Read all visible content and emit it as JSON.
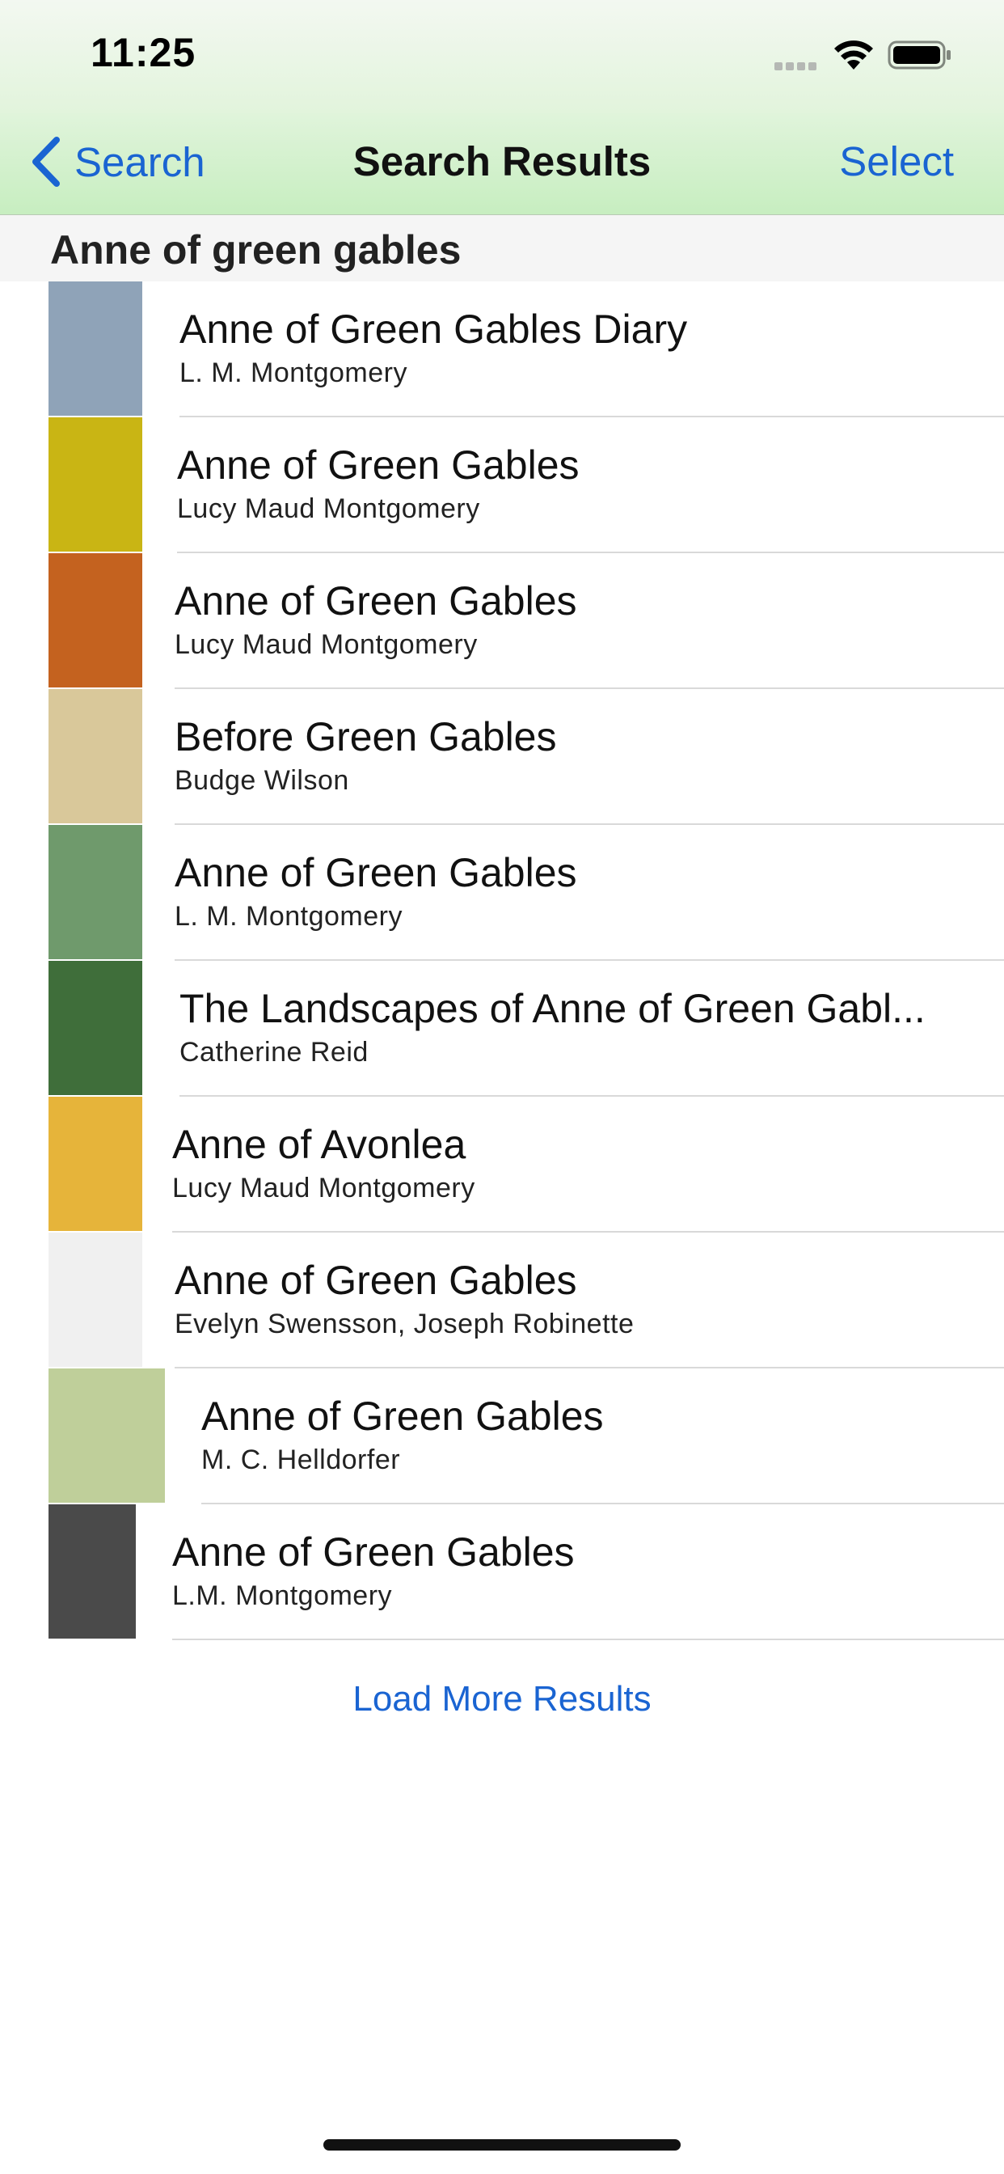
{
  "status_bar": {
    "time": "11:25"
  },
  "nav": {
    "back_label": "Search",
    "title": "Search Results",
    "select_label": "Select"
  },
  "section": {
    "header": "Anne of green gables"
  },
  "results": [
    {
      "title": "Anne of Green Gables Diary",
      "author": "L. M. Montgomery",
      "cover_color": "#8fa3b8"
    },
    {
      "title": "Anne of Green Gables",
      "author": "Lucy Maud Montgomery",
      "cover_color": "#c9b514"
    },
    {
      "title": "Anne of Green Gables",
      "author": "Lucy Maud Montgomery",
      "cover_color": "#c4621f"
    },
    {
      "title": "Before Green Gables",
      "author": "Budge Wilson",
      "cover_color": "#d9c89a"
    },
    {
      "title": "Anne of Green Gables",
      "author": "L. M. Montgomery",
      "cover_color": "#6f9a6c"
    },
    {
      "title": "The Landscapes of Anne of Green Gabl...",
      "author": "Catherine Reid",
      "cover_color": "#3f6e3a"
    },
    {
      "title": "Anne of Avonlea",
      "author": "Lucy Maud Montgomery",
      "cover_color": "#e6b43a"
    },
    {
      "title": "Anne of Green Gables",
      "author": "Evelyn Swensson, Joseph Robinette",
      "cover_color": "#f0f0f0"
    },
    {
      "title": "Anne of Green Gables",
      "author": "M. C. Helldorfer",
      "cover_color": "#bfcf9a"
    },
    {
      "title": "Anne of Green Gables",
      "author": "L.M. Montgomery",
      "cover_color": "#4a4a4a"
    }
  ],
  "load_more_label": "Load More Results"
}
